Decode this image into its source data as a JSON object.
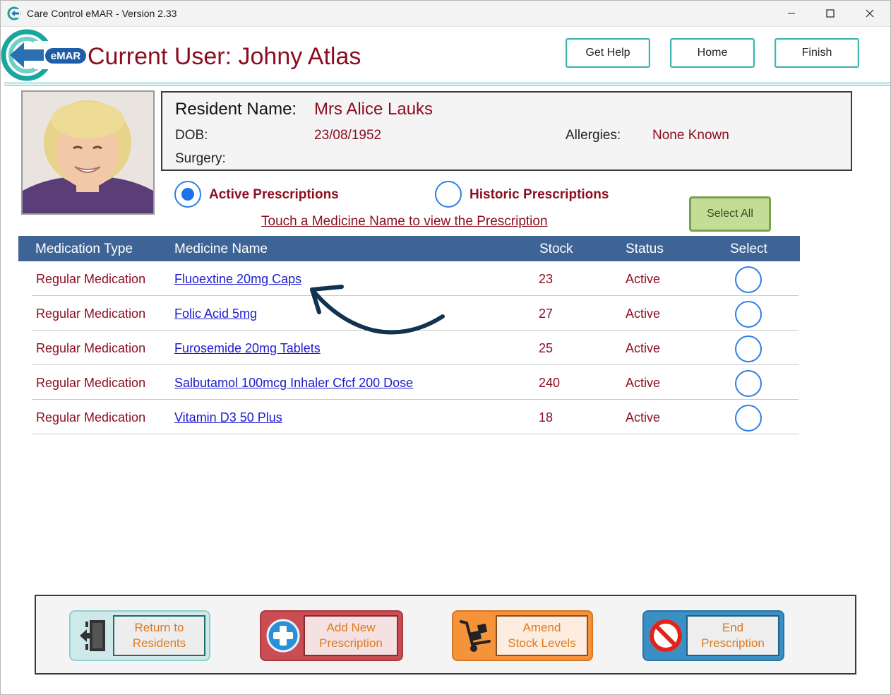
{
  "window": {
    "title": "Care Control eMAR - Version 2.33",
    "minimize_icon": "minimize-icon",
    "maximize_icon": "maximize-icon",
    "close_icon": "close-icon"
  },
  "header": {
    "logo_text": "eMAR",
    "current_user": "Current User: Johny Atlas",
    "buttons": {
      "help": "Get Help",
      "home": "Home",
      "finish": "Finish"
    },
    "accent_color": "#3fb6b0"
  },
  "resident": {
    "name_label": "Resident Name:",
    "name": "Mrs Alice Lauks",
    "dob_label": "DOB:",
    "dob": "23/08/1952",
    "allergies_label": "Allergies:",
    "allergies": "None Known",
    "surgery_label": "Surgery:",
    "surgery": ""
  },
  "filters": {
    "active_label": "Active Prescriptions",
    "historic_label": "Historic Prescriptions",
    "selected": "active",
    "hint": "Touch a Medicine Name to view the Prescription",
    "select_all": "Select All"
  },
  "table": {
    "columns": [
      "Medication Type",
      "Medicine Name",
      "Stock",
      "Status",
      "Select"
    ],
    "rows": [
      {
        "type": "Regular Medication",
        "name": "Fluoextine 20mg Caps",
        "stock": "23",
        "status": "Active"
      },
      {
        "type": "Regular Medication",
        "name": "Folic Acid 5mg",
        "stock": "27",
        "status": "Active"
      },
      {
        "type": "Regular Medication",
        "name": "Furosemide 20mg Tablets",
        "stock": "25",
        "status": "Active"
      },
      {
        "type": "Regular Medication",
        "name": "Salbutamol 100mcg Inhaler Cfcf 200 Dose",
        "stock": "240",
        "status": "Active"
      },
      {
        "type": "Regular Medication",
        "name": "Vitamin D3 50 Plus",
        "stock": "18",
        "status": "Active"
      }
    ],
    "header_color": "#3e6496"
  },
  "actions": {
    "return": "Return to\nResidents",
    "add": "Add New\nPrescription",
    "amend": "Amend\nStock Levels",
    "end": "End\nPrescription"
  }
}
